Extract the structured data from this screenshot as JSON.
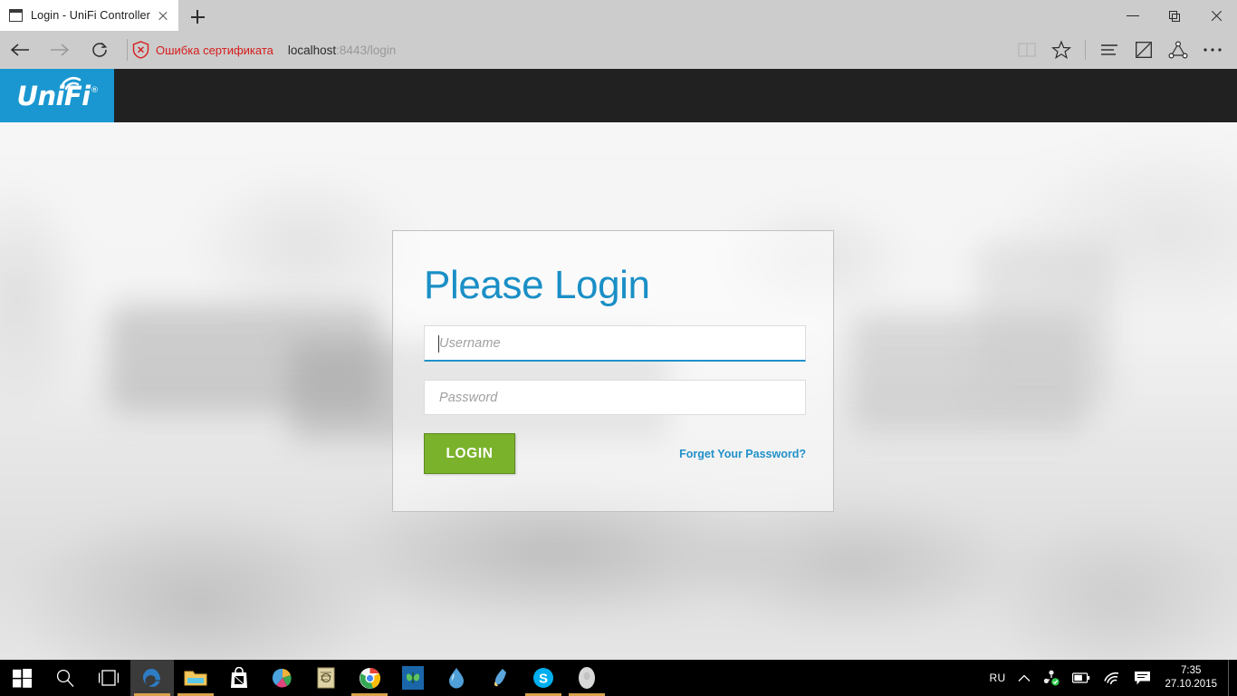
{
  "browser": {
    "tab": {
      "title": "Login - UniFi Controller",
      "favicon_name": "window-icon",
      "close_label": "×"
    },
    "newtab_label": "+",
    "window_controls": {
      "minimize": "—",
      "restore": "❐",
      "close": "✕"
    },
    "nav": {
      "back": "Back",
      "forward": "Forward",
      "refresh": "Refresh"
    },
    "address": {
      "cert_warning": "Ошибка сертификата",
      "url_host": "localhost",
      "url_rest": ":8443/login",
      "cert_color": "#d61c1c"
    },
    "tools": [
      {
        "name": "reading-view-icon",
        "label": "Reading view"
      },
      {
        "name": "favorites-icon",
        "label": "Favorites"
      },
      {
        "name": "hub-icon",
        "label": "Hub"
      },
      {
        "name": "web-note-icon",
        "label": "Make a Web Note"
      },
      {
        "name": "share-icon",
        "label": "Share"
      },
      {
        "name": "more-icon",
        "label": "More"
      }
    ]
  },
  "page": {
    "brand": {
      "logo_text": "UniFi",
      "registered_mark": "®",
      "logo_bg": "#1a97d0",
      "topbar_bg": "#212121"
    },
    "login_card": {
      "title": "Please Login",
      "title_color": "#1a8fc6",
      "username": {
        "placeholder": "Username",
        "value": "",
        "focused": true
      },
      "password": {
        "placeholder": "Password",
        "value": "",
        "focused": false
      },
      "login_button": {
        "label": "LOGIN",
        "color": "#7bb22b"
      },
      "forget_link": {
        "label": "Forget Your Password?",
        "color": "#2191c9"
      }
    }
  },
  "taskbar": {
    "start_label": "Start",
    "search_label": "Search",
    "taskview_label": "Task view",
    "apps": [
      {
        "name": "taskbar-app-edge",
        "label": "Microsoft Edge",
        "glyph": "e",
        "color": "#2e7cc4",
        "bg": "transparent",
        "active": true,
        "underline": "#d8a24a"
      },
      {
        "name": "taskbar-app-file-explorer",
        "label": "File Explorer",
        "glyph": "▤",
        "color": "#f0c040",
        "bg": "transparent",
        "active": false,
        "underline": "#d8a24a"
      },
      {
        "name": "taskbar-app-store",
        "label": "Store",
        "glyph": "▦",
        "color": "#ffffff",
        "bg": "transparent",
        "active": false,
        "underline": "transparent"
      },
      {
        "name": "taskbar-app-photos",
        "label": "Photos",
        "glyph": "◕",
        "color": "#e04a86",
        "bg": "transparent",
        "active": false,
        "underline": "transparent"
      },
      {
        "name": "taskbar-app-notes",
        "label": "Notes",
        "glyph": "▤",
        "color": "#d9c07a",
        "bg": "transparent",
        "active": false,
        "underline": "transparent"
      },
      {
        "name": "taskbar-app-chrome",
        "label": "Google Chrome",
        "glyph": "◉",
        "color": "#35a853",
        "bg": "transparent",
        "active": false,
        "underline": "#d8a24a"
      },
      {
        "name": "taskbar-app-butterfly",
        "label": "Butterfly app",
        "glyph": "✦",
        "color": "#4fbf4f",
        "bg": "#1a66a8",
        "active": false,
        "underline": "transparent"
      },
      {
        "name": "taskbar-app-drop",
        "label": "Blue drop app",
        "glyph": "◒",
        "color": "#5ba6dd",
        "bg": "transparent",
        "active": false,
        "underline": "transparent"
      },
      {
        "name": "taskbar-app-brush",
        "label": "Brush app",
        "glyph": "✎",
        "color": "#5ba6dd",
        "bg": "transparent",
        "active": false,
        "underline": "transparent"
      },
      {
        "name": "taskbar-app-skype",
        "label": "Skype",
        "glyph": "S",
        "color": "#00aff0",
        "bg": "transparent",
        "active": false,
        "underline": "#d8a24a"
      },
      {
        "name": "taskbar-app-oval",
        "label": "Gray app",
        "glyph": "◯",
        "color": "#d5d5d5",
        "bg": "transparent",
        "active": false,
        "underline": "#d8a24a"
      }
    ],
    "tray": {
      "language": "RU",
      "chevron_label": "Show hidden icons",
      "icons": [
        {
          "name": "sync-status-icon",
          "label": "Sync status"
        },
        {
          "name": "battery-icon",
          "label": "Battery"
        },
        {
          "name": "wifi-icon",
          "label": "Network"
        },
        {
          "name": "action-center-icon",
          "label": "Action center"
        }
      ],
      "time": "7:35",
      "date": "27.10.2015"
    }
  }
}
